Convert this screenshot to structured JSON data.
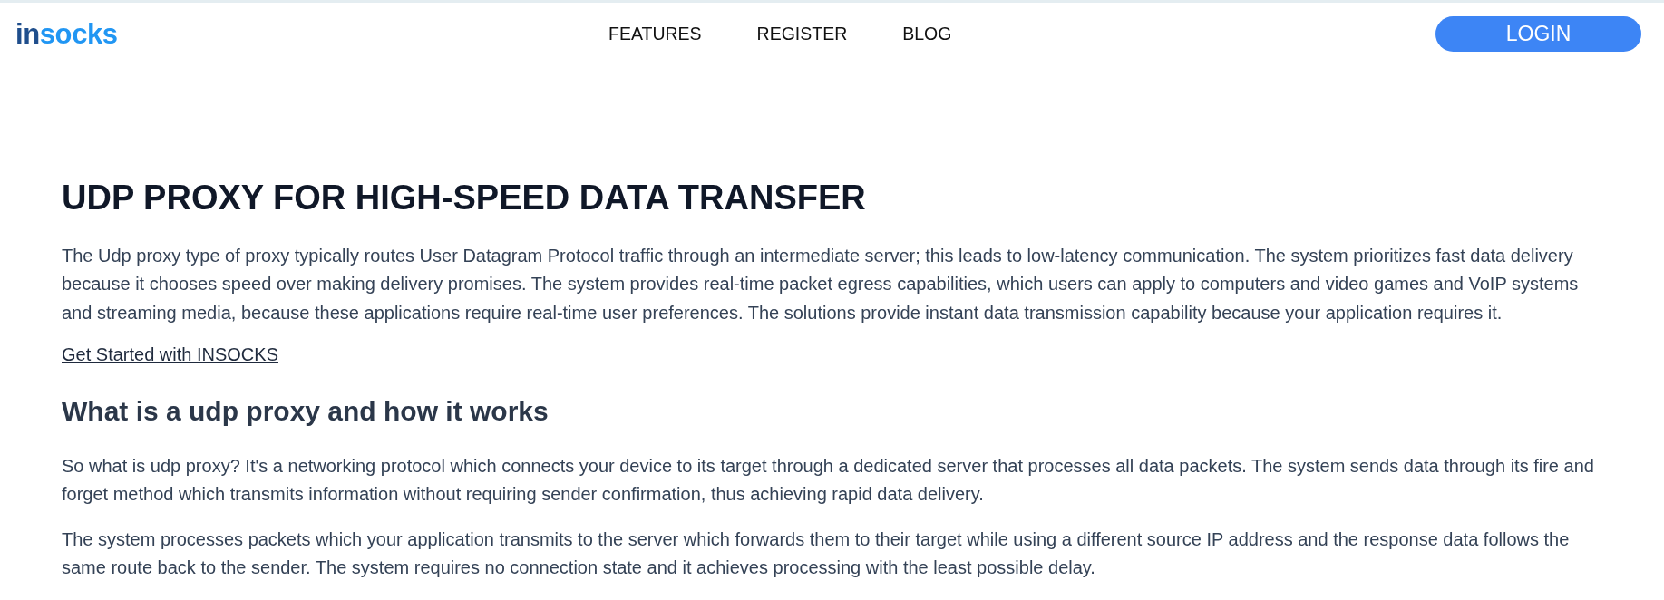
{
  "header": {
    "logo": {
      "parts": [
        {
          "text": "in",
          "color": "#1f4e8c"
        },
        {
          "text": "socks",
          "color": "#2196f3"
        }
      ]
    },
    "nav": [
      "FEATURES",
      "REGISTER",
      "BLOG"
    ],
    "login_button": "LOGIN"
  },
  "article": {
    "title": "UDP PROXY FOR HIGH-SPEED DATA TRANSFER",
    "intro": "The Udp proxy type of proxy typically routes User Datagram Protocol traffic through an intermediate server; this leads to low-latency communication. The system prioritizes fast data delivery because it chooses speed over making delivery promises. The system provides real-time packet egress capabilities, which users can apply to computers and video games and VoIP systems and streaming media, because these applications require real-time user preferences. The solutions provide instant data transmission capability because your application requires it.",
    "link": "Get Started with INSOCKS",
    "sections": [
      {
        "heading": "What is a udp proxy and how it works",
        "paragraphs": [
          "So what is udp proxy? It's a networking protocol which connects your device to its target through a dedicated server that processes all data packets. The system sends data through its fire and forget method which transmits information without requiring sender confirmation, thus achieving rapid data delivery.",
          "The system processes packets which your application transmits to the server which forwards them to their target while using a different source IP address and the response data follows the same route back to the sender. The system requires no connection state and it achieves processing with the least possible delay."
        ]
      }
    ]
  }
}
